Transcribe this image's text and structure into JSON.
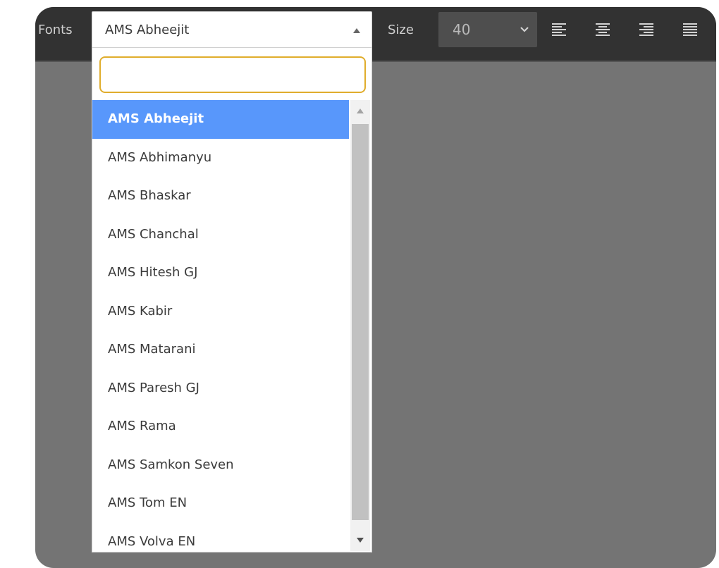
{
  "toolbar": {
    "fonts_label": "Fonts",
    "size_label": "Size",
    "size_value": "40",
    "align_icons": [
      "align-left-icon",
      "align-center-icon",
      "align-right-icon",
      "align-justify-icon"
    ]
  },
  "font_select": {
    "selected": "AMS Abheejit",
    "search_value": "",
    "options": [
      "AMS Abheejit",
      "AMS Abhimanyu",
      "AMS Bhaskar",
      "AMS Chanchal",
      "AMS Hitesh GJ",
      "AMS Kabir",
      "AMS Matarani",
      "AMS Paresh GJ",
      "AMS Rama",
      "AMS Samkon Seven",
      "AMS Tom EN",
      "AMS Volva EN"
    ]
  },
  "colors": {
    "canvas": "#747474",
    "toolbar": "#323232",
    "highlight": "#5897fb",
    "focus_border": "#e0ad2c"
  }
}
